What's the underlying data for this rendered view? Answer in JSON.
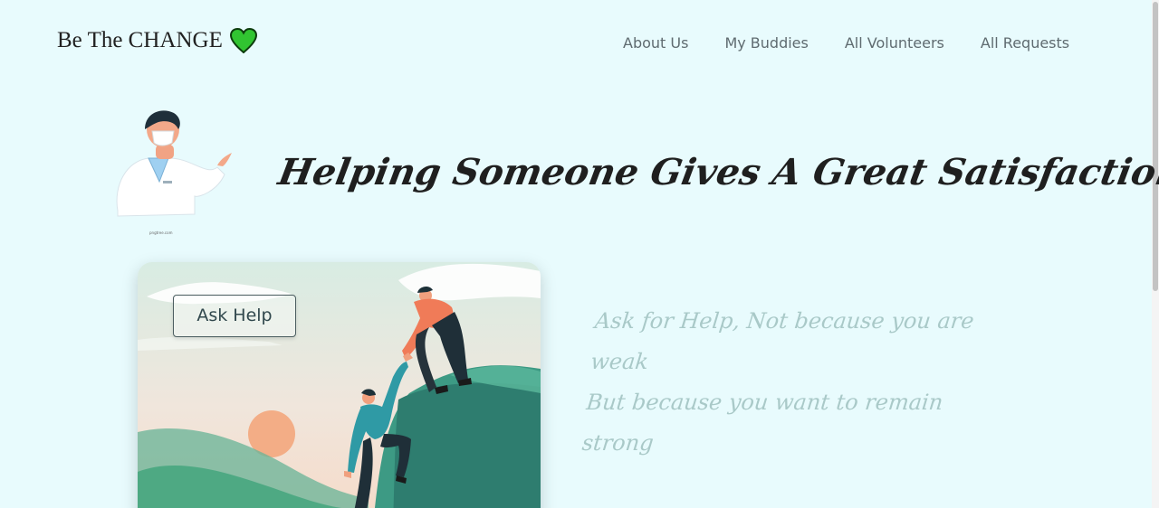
{
  "brand": {
    "name": "Be The CHANGE",
    "icon": "heart-icon",
    "icon_color": "#2fc22f"
  },
  "nav": {
    "items": [
      {
        "label": "About Us"
      },
      {
        "label": "My Buddies"
      },
      {
        "label": "All Volunteers"
      },
      {
        "label": "All Requests"
      }
    ]
  },
  "hero": {
    "headline": "Helping Someone Gives A Great Satisfaction",
    "doctor_caption": "pngtree.com",
    "ask_help_label": "Ask Help",
    "quote_lines": [
      "Ask for Help, Not because you are weak",
      "But because you want to remain",
      "strong"
    ]
  },
  "colors": {
    "background": "#e8fbfd",
    "nav_text": "#5f6b70",
    "quote_text": "#a9c9c8",
    "headline_text": "#1f1f1f"
  }
}
